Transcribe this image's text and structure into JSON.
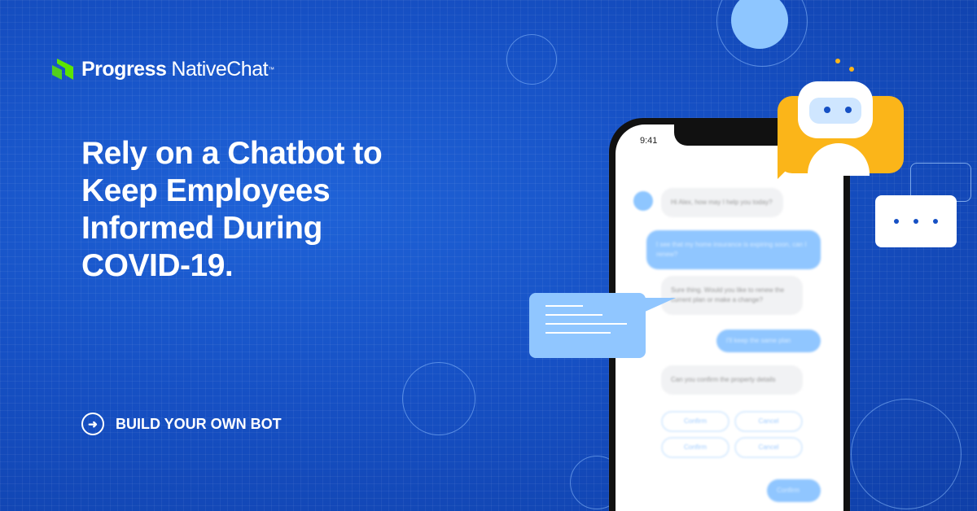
{
  "brand": {
    "name": "Progress",
    "product": "NativeChat",
    "trademark": "™",
    "accent": "#5ce500"
  },
  "headline": "Rely on a Chatbot to Keep Employees Informed During COVID-19.",
  "cta": {
    "label": "BUILD YOUR OWN BOT",
    "icon": "arrow-right-circle-icon"
  },
  "phone": {
    "status_time": "9:41",
    "messages": [
      {
        "from": "bot",
        "text": "Hi Alex, how may I help you today?"
      },
      {
        "from": "user",
        "text": "I see that my home insurance is expiring soon, can I renew?"
      },
      {
        "from": "bot",
        "text": "Sure thing. Would you like to renew the current plan or make a change?"
      },
      {
        "from": "user",
        "text": "I'll keep the same plan"
      },
      {
        "from": "bot",
        "text": "Can you confirm the property details"
      }
    ],
    "buttons": [
      "Confirm",
      "Cancel",
      "Confirm",
      "Cancel"
    ],
    "send_label": "Confirm"
  },
  "colors": {
    "background": "#1650c4",
    "bot_yellow": "#fbb519",
    "bubble_light": "#90c6ff"
  }
}
